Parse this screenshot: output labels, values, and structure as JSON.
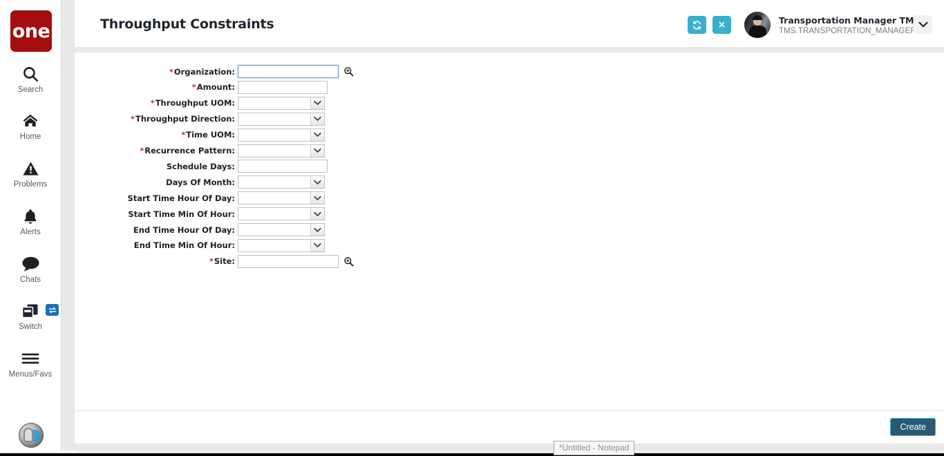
{
  "sidebar": {
    "logo_text": "one",
    "items": [
      {
        "icon": "search-icon",
        "label": "Search"
      },
      {
        "icon": "home-icon",
        "label": "Home"
      },
      {
        "icon": "warning-icon",
        "label": "Problems"
      },
      {
        "icon": "bell-icon",
        "label": "Alerts"
      },
      {
        "icon": "chat-icon",
        "label": "Chats"
      },
      {
        "icon": "switch-icon",
        "label": "Switch"
      },
      {
        "icon": "hamburger-icon",
        "label": "Menus/Favs"
      }
    ],
    "switch_badge_icon": "swap-arrows-icon",
    "bottom_avatar_icon": "assistant-avatar-icon"
  },
  "header": {
    "title": "Throughput Constraints",
    "refresh_button": {
      "icon": "refresh-icon",
      "label": "Refresh"
    },
    "close_button": {
      "icon": "close-icon",
      "label": "×"
    },
    "user": {
      "avatar_icon": "user-avatar",
      "name": "Transportation Manager TM",
      "role": "TMS.TRANSPORTATION_MANAGER"
    },
    "menu_toggle_icon": "chevron-down-icon"
  },
  "form": {
    "fields": [
      {
        "label": "Organization:",
        "required": true,
        "type": "lookup",
        "value": "",
        "focused": true,
        "name": "organization"
      },
      {
        "label": "Amount:",
        "required": true,
        "type": "text",
        "value": "",
        "focused": false,
        "name": "amount"
      },
      {
        "label": "Throughput UOM:",
        "required": true,
        "type": "select",
        "value": "",
        "focused": false,
        "name": "throughput-uom"
      },
      {
        "label": "Throughput Direction:",
        "required": true,
        "type": "select",
        "value": "",
        "focused": false,
        "name": "throughput-direction"
      },
      {
        "label": "Time UOM:",
        "required": true,
        "type": "select",
        "value": "",
        "focused": false,
        "name": "time-uom"
      },
      {
        "label": "Recurrence Pattern:",
        "required": true,
        "type": "select",
        "value": "",
        "focused": false,
        "name": "recurrence-pattern"
      },
      {
        "label": "Schedule Days:",
        "required": false,
        "type": "text",
        "value": "",
        "focused": false,
        "name": "schedule-days"
      },
      {
        "label": "Days Of Month:",
        "required": false,
        "type": "select",
        "value": "",
        "focused": false,
        "name": "days-of-month"
      },
      {
        "label": "Start Time Hour Of Day:",
        "required": false,
        "type": "select",
        "value": "",
        "focused": false,
        "name": "start-time-hour-of-day"
      },
      {
        "label": "Start Time Min Of Hour:",
        "required": false,
        "type": "select",
        "value": "",
        "focused": false,
        "name": "start-time-min-of-hour"
      },
      {
        "label": "End Time Hour Of Day:",
        "required": false,
        "type": "select",
        "value": "",
        "focused": false,
        "name": "end-time-hour-of-day"
      },
      {
        "label": "End Time Min Of Hour:",
        "required": false,
        "type": "select",
        "value": "",
        "focused": false,
        "name": "end-time-min-of-hour"
      },
      {
        "label": "Site:",
        "required": true,
        "type": "lookup",
        "value": "",
        "focused": false,
        "name": "site"
      }
    ],
    "required_marker": "*",
    "lookup_icon": "magnifier-icon"
  },
  "footer": {
    "create_label": "Create"
  },
  "taskbar": {
    "tooltip_text": "*Untitled - Notepad"
  },
  "colors": {
    "brand_red": "#a50e0e",
    "accent_teal": "#3aafcd",
    "create_button_bg": "#2c5871",
    "required_red": "#c0392b",
    "focus_blue": "#5b9bd5",
    "page_bg": "#e8e8e8"
  }
}
